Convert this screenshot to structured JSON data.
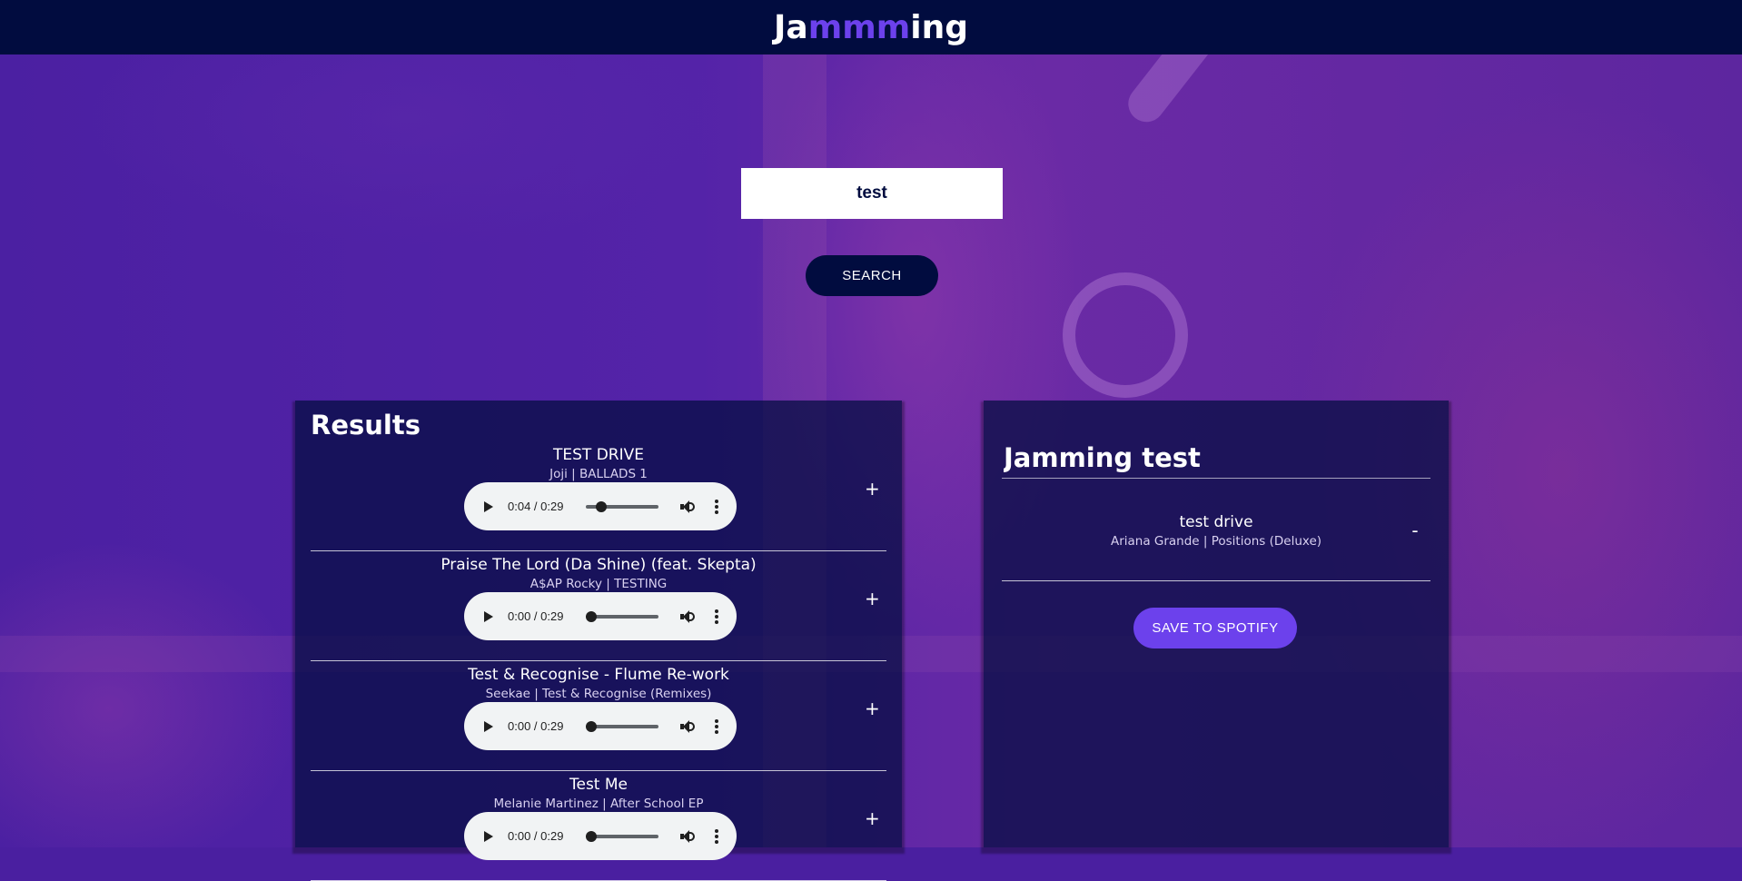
{
  "app": {
    "logo_prefix": "Ja",
    "logo_highlight": "mmm",
    "logo_suffix": "ing",
    "accent_color": "#6c41ec",
    "header_color": "#010c3f"
  },
  "search": {
    "value": "test",
    "button_label": "SEARCH"
  },
  "results": {
    "title": "Results",
    "tracks": [
      {
        "name": "TEST DRIVE",
        "meta": "Joji | BALLADS 1",
        "time": "0:04 / 0:29",
        "progress": 0.14,
        "action": "+"
      },
      {
        "name": "Praise The Lord (Da Shine) (feat. Skepta)",
        "meta": "A$AP Rocky | TESTING",
        "time": "0:00 / 0:29",
        "progress": 0,
        "action": "+"
      },
      {
        "name": "Test & Recognise - Flume Re-work",
        "meta": "Seekae | Test & Recognise (Remixes)",
        "time": "0:00 / 0:29",
        "progress": 0,
        "action": "+"
      },
      {
        "name": "Test Me",
        "meta": "Melanie Martinez | After School EP",
        "time": "0:00 / 0:29",
        "progress": 0,
        "action": "+"
      }
    ]
  },
  "playlist": {
    "name": "Jamming test",
    "tracks": [
      {
        "name": "test drive",
        "meta": "Ariana Grande | Positions (Deluxe)",
        "action": "-"
      }
    ],
    "save_label": "SAVE TO SPOTIFY"
  },
  "icons": {
    "play": "play-icon",
    "volume": "volume-icon",
    "more": "more-vertical-icon"
  }
}
